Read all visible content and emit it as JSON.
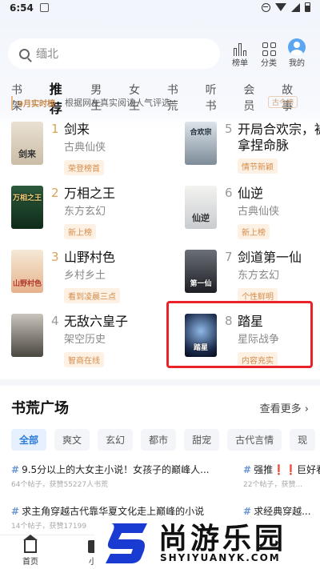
{
  "status_bar": {
    "time": "6:54"
  },
  "search": {
    "placeholder": "缅北"
  },
  "top_actions": [
    {
      "label": "榜单",
      "icon": "chart-bars-icon"
    },
    {
      "label": "分类",
      "icon": "grid-icon"
    },
    {
      "label": "我的",
      "icon": "avatar-icon"
    }
  ],
  "tabs": [
    "书架",
    "推荐",
    "男生",
    "女生",
    "书荒",
    "听书",
    "会员",
    "故事"
  ],
  "active_tab": "推荐",
  "banner": {
    "badge": "9月实时榜",
    "desc": "根据网友真实阅读人气评选",
    "stamp": "古今榜"
  },
  "books": [
    {
      "rank": "1",
      "title": "剑来",
      "genre": "古典仙侠",
      "tag": "荣登榜首",
      "cover_text": "剑来"
    },
    {
      "rank": "2",
      "title": "万相之王",
      "genre": "东方玄幻",
      "tag": "新上榜",
      "cover_text": "万相之王"
    },
    {
      "rank": "3",
      "title": "山野村色",
      "genre": "乡村乡土",
      "tag": "看到凌晨三点",
      "cover_text": "山野村色"
    },
    {
      "rank": "4",
      "title": "无敌六皇子",
      "genre": "架空历史",
      "tag": "智商在线",
      "cover_text": ""
    },
    {
      "rank": "5",
      "title": "开局合欢宗，被拿捏命脉",
      "genre": "",
      "tag": "情节新颖",
      "cover_text": "合欢宗"
    },
    {
      "rank": "6",
      "title": "仙逆",
      "genre": "古典仙侠",
      "tag": "新上榜",
      "cover_text": "仙逆"
    },
    {
      "rank": "7",
      "title": "剑道第一仙",
      "genre": "东方玄幻",
      "tag": "个性鲜明",
      "cover_text": "第一仙"
    },
    {
      "rank": "8",
      "title": "踏星",
      "genre": "星际战争",
      "tag": "内容充实",
      "cover_text": "踏星"
    }
  ],
  "section": {
    "title": "书荒广场",
    "more": "查看更多 ›"
  },
  "chips": [
    "全部",
    "爽文",
    "玄幻",
    "都市",
    "甜宠",
    "古代言情",
    "现"
  ],
  "posts": [
    {
      "title": "9.5分以上的大女主小说！女孩子的巅峰人...",
      "meta": "64个帖子，获赞55227人书荒"
    },
    {
      "title": "强推❗️❗️巨好看",
      "meta": "22个帖子，获赞..."
    },
    {
      "title": "求主角穿越古代靠华夏文化走上巅峰的小说",
      "meta": "14个帖子，获赞17199"
    },
    {
      "title": "求经典穿越...",
      "meta": ""
    }
  ],
  "bottom_nav": {
    "home": "首页",
    "second": "小"
  },
  "watermark": {
    "cn": "尚游乐园",
    "en": "SHYIYUANYK.COM"
  }
}
